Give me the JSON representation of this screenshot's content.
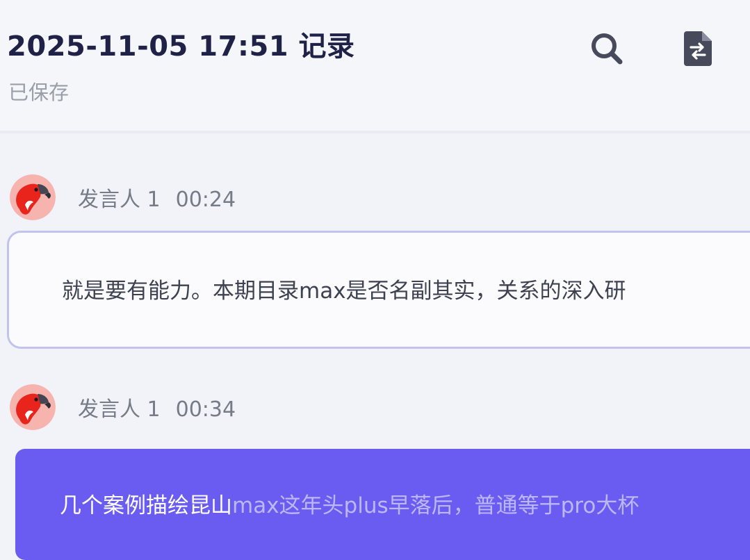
{
  "header": {
    "title": "2025-11-05 17:51 记录",
    "status": "已保存",
    "icons": {
      "search": "search-icon",
      "switch_doc": "document-swap-icon"
    }
  },
  "transcript": [
    {
      "speaker": "发言人 1",
      "timestamp": "00:24",
      "text": "就是要有能力。本期目录max是否名副其实，关系的深入研",
      "state": "normal"
    },
    {
      "speaker": "发言人 1",
      "timestamp": "00:34",
      "text_played": "几个案例描绘昆山",
      "text_unplayed": "max这年头plus早落后，普通等于pro大杯",
      "state": "playing"
    }
  ],
  "colors": {
    "title": "#1f2147",
    "accent": "#6a5cf0",
    "bubble_border": "#c1c3ef",
    "avatar_bg": "#f7b3ad",
    "avatar_bird": "#e8241c"
  }
}
